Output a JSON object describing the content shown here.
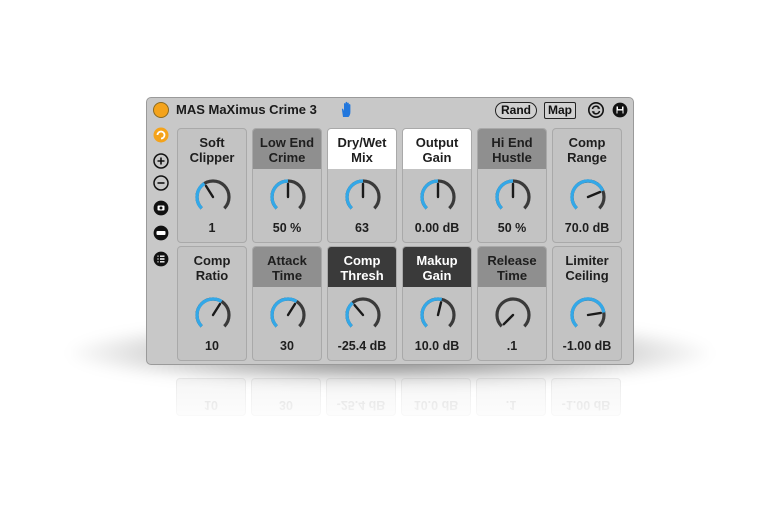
{
  "device": {
    "title": "MAS MaXimus Crime 3",
    "rand_label": "Rand",
    "map_label": "Map",
    "accent_color": "#f4a31b",
    "knob_color": "#33a8e8"
  },
  "row1": [
    {
      "label": "Soft\nClipper",
      "value": "1",
      "style": "gray",
      "level": 0.38
    },
    {
      "label": "Low End\nCrime",
      "value": "50 %",
      "style": "dark",
      "level": 0.5
    },
    {
      "label": "Dry/Wet\nMix",
      "value": "63",
      "style": "white",
      "level": 0.5
    },
    {
      "label": "Output\nGain",
      "value": "0.00 dB",
      "style": "white",
      "level": 0.5
    },
    {
      "label": "Hi End\nHustle",
      "value": "50 %",
      "style": "dark",
      "level": 0.5
    },
    {
      "label": "Comp\nRange",
      "value": "70.0 dB",
      "style": "gray",
      "level": 0.75
    }
  ],
  "row2": [
    {
      "label": "Comp\nRatio",
      "value": "10",
      "style": "gray",
      "level": 0.62
    },
    {
      "label": "Attack\nTime",
      "value": "30",
      "style": "dark",
      "level": 0.62
    },
    {
      "label": "Comp\nThresh",
      "value": "-25.4 dB",
      "style": "black",
      "level": 0.35
    },
    {
      "label": "Makup\nGain",
      "value": "10.0 dB",
      "style": "black",
      "level": 0.55
    },
    {
      "label": "Release\nTime",
      "value": ".1",
      "style": "dark",
      "level": 0.0
    },
    {
      "label": "Limiter\nCeiling",
      "value": "-1.00 dB",
      "style": "gray",
      "level": 0.8
    }
  ]
}
